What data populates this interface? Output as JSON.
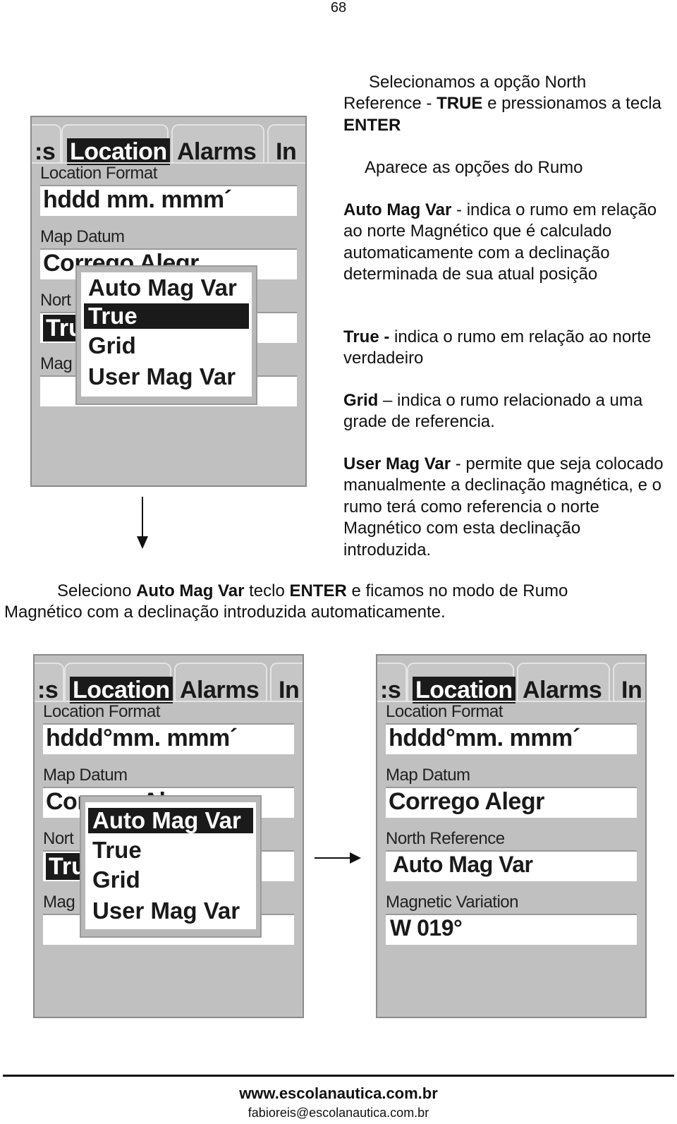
{
  "page_number": "68",
  "intro": {
    "p1_a": "Selecionamos a opção North Reference  - ",
    "p1_b": "TRUE",
    "p1_c": "  e pressionamos a tecla ",
    "p1_d": "ENTER",
    "p2": "Aparece as opções do Rumo"
  },
  "definitions": [
    {
      "term": "Auto Mag Var",
      "text": " - indica o rumo em relação ao norte Magnético que é calculado automaticamente com a declinação determinada de sua atual posição"
    },
    {
      "term": "True -",
      "text": "  indica o rumo em relação ao norte verdadeiro"
    },
    {
      "term": "Grid",
      "text": " – indica o rumo relacionado a uma grade de referencia."
    },
    {
      "term": "User Mag Var",
      "text": " - permite que seja colocado manualmente a declinação magnética, e o rumo terá como referencia o norte Magnético com esta declinação introduzida."
    }
  ],
  "summary": {
    "a": "Seleciono ",
    "b": "Auto Mag Var",
    "c": " teclo ",
    "d": "ENTER",
    "e": " e ficamos no modo de Rumo Magnético com a declinação introduzida automaticamente."
  },
  "device": {
    "tabs": [
      ":s",
      "Location",
      "Alarms",
      "In"
    ],
    "active_tab": "Location",
    "location_format_label": "Location Format",
    "map_datum_label": "Map Datum",
    "north_ref_label_partial": "Nort",
    "mag_label_partial": "Mag",
    "datum_partial": "Corrego Alegr",
    "tru_partial": "Tru",
    "menu_options": [
      "Auto Mag Var",
      "True",
      "Grid",
      "User Mag Var"
    ]
  },
  "screen1": {
    "location_format_value": "hddd mm. mmm´",
    "selected_option": "True"
  },
  "screen2": {
    "location_format_value": "hddd°mm. mmm´",
    "selected_option": "Auto Mag Var"
  },
  "screen3": {
    "location_format_value": "hddd°mm. mmm´",
    "map_datum_value": "Corrego Alegr",
    "north_reference_label": "North Reference",
    "north_reference_value": "Auto Mag Var",
    "magnetic_variation_label": "Magnetic Variation",
    "magnetic_variation_value": "W 019°"
  },
  "footer": {
    "website": "www.escolanautica.com.br",
    "email": "fabioreis@escolanautica.com.br"
  }
}
